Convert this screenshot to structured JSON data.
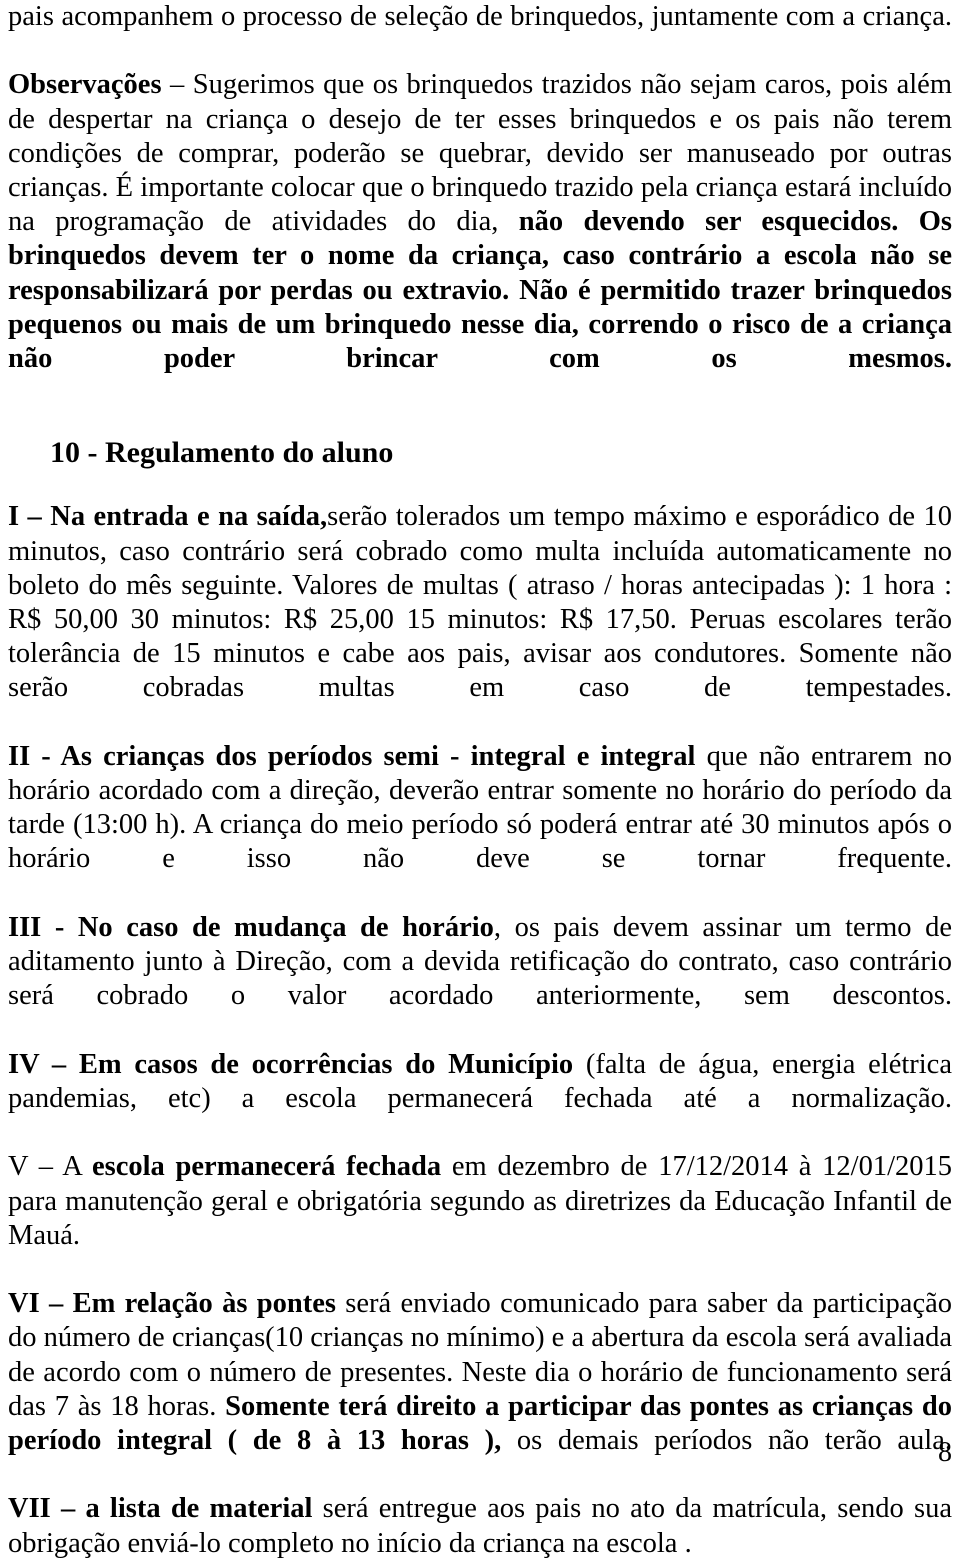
{
  "document": {
    "language": "pt-BR",
    "page_number": "8",
    "paragraphs": [
      {
        "id": "p-brinquedos-cont",
        "type": "paragraph",
        "runs": [
          {
            "text": "pais acompanhem o processo de seleção de brinquedos, juntamente com a criança.",
            "bold": false
          }
        ]
      },
      {
        "id": "p-observacoes",
        "type": "paragraph",
        "runs": [
          {
            "text": "Observações",
            "bold": true
          },
          {
            "text": " – Sugerimos que os brinquedos trazidos não sejam caros, pois além de despertar  na criança o desejo de ter esses brinquedos e os pais não terem condições de comprar, poderão se quebrar, devido ser manuseado por outras crianças. É importante colocar que o brinquedo trazido pela criança estará incluído na programação de atividades do dia, ",
            "bold": false
          },
          {
            "text": "não devendo ser esquecidos. Os brinquedos devem ter o nome da criança, caso contrário a escola não se responsabilizará por perdas ou extravio. Não é permitido trazer brinquedos pequenos ou mais de um brinquedo nesse dia, correndo o risco de a criança não poder brincar com os mesmos.",
            "bold": true
          }
        ]
      }
    ],
    "section_heading": {
      "id": "h-regulamento",
      "text": "10 - Regulamento do aluno"
    },
    "rules": [
      {
        "id": "rule-i",
        "numeral": "I",
        "runs": [
          {
            "text": "I – Na entrada e na saída,",
            "bold": true
          },
          {
            "text": "serão tolerados um tempo máximo e esporádico de 10 minutos, caso contrário será cobrado como multa incluída automaticamente no boleto do mês seguinte. Valores de multas ( atraso / horas antecipadas ): 1 hora : R$ 50,00  30 minutos: R$ 25,00 15 minutos: R$ 17,50. Peruas escolares terão tolerância de 15 minutos e cabe aos pais, avisar aos condutores. Somente não serão cobradas multas em caso de tempestades.",
            "bold": false
          }
        ]
      },
      {
        "id": "rule-ii",
        "numeral": "II",
        "runs": [
          {
            "text": "II - As crianças dos períodos semi - integral e integral",
            "bold": true
          },
          {
            "text": " que não entrarem no horário acordado com a direção, deverão entrar somente no horário do período da tarde (13:00 h). A criança do meio período só poderá entrar até 30 minutos após o horário e isso não deve se tornar frequente.",
            "bold": false
          }
        ]
      },
      {
        "id": "rule-iii",
        "numeral": "III",
        "runs": [
          {
            "text": "III - No caso de mudança de horário",
            "bold": true
          },
          {
            "text": ", os pais devem assinar um termo de aditamento junto à Direção, com a devida retificação do contrato, caso contrário será cobrado o valor acordado anteriormente, sem descontos.",
            "bold": false
          }
        ]
      },
      {
        "id": "rule-iv",
        "numeral": "IV",
        "runs": [
          {
            "text": "IV – Em casos de ocorrências do Município",
            "bold": true
          },
          {
            "text": " (falta de água, energia elétrica pandemias, etc) a escola permanecerá fechada até a normalização.",
            "bold": false
          }
        ]
      },
      {
        "id": "rule-v",
        "numeral": "V",
        "runs": [
          {
            "text": "V – A ",
            "bold": false
          },
          {
            "text": "escola permanecerá fechada",
            "bold": true
          },
          {
            "text": " em dezembro de 17/12/2014 à 12/01/2015 para manutenção geral e obrigatória segundo as diretrizes da Educação Infantil de Mauá.",
            "bold": false
          }
        ]
      },
      {
        "id": "rule-vi",
        "numeral": "VI",
        "runs": [
          {
            "text": "VI – Em relação às pontes",
            "bold": true
          },
          {
            "text": " será enviado comunicado para saber da participação do número de crianças(10 crianças no mínimo) e a abertura da escola será avaliada de acordo com o número de presentes. Neste dia o horário de funcionamento será das 7 às 18 horas. ",
            "bold": false
          },
          {
            "text": "Somente terá direito a participar das pontes as crianças do período integral ( de 8 à 13 horas ),",
            "bold": true
          },
          {
            "text": " os demais períodos não terão aula.",
            "bold": false
          }
        ]
      },
      {
        "id": "rule-vii",
        "numeral": "VII",
        "runs": [
          {
            "text": "VII – a lista de material",
            "bold": true
          },
          {
            "text": " será entregue aos pais no ato da matrícula, sendo sua obrigação enviá-lo completo no início da criança na escola .",
            "bold": false
          }
        ]
      }
    ]
  }
}
